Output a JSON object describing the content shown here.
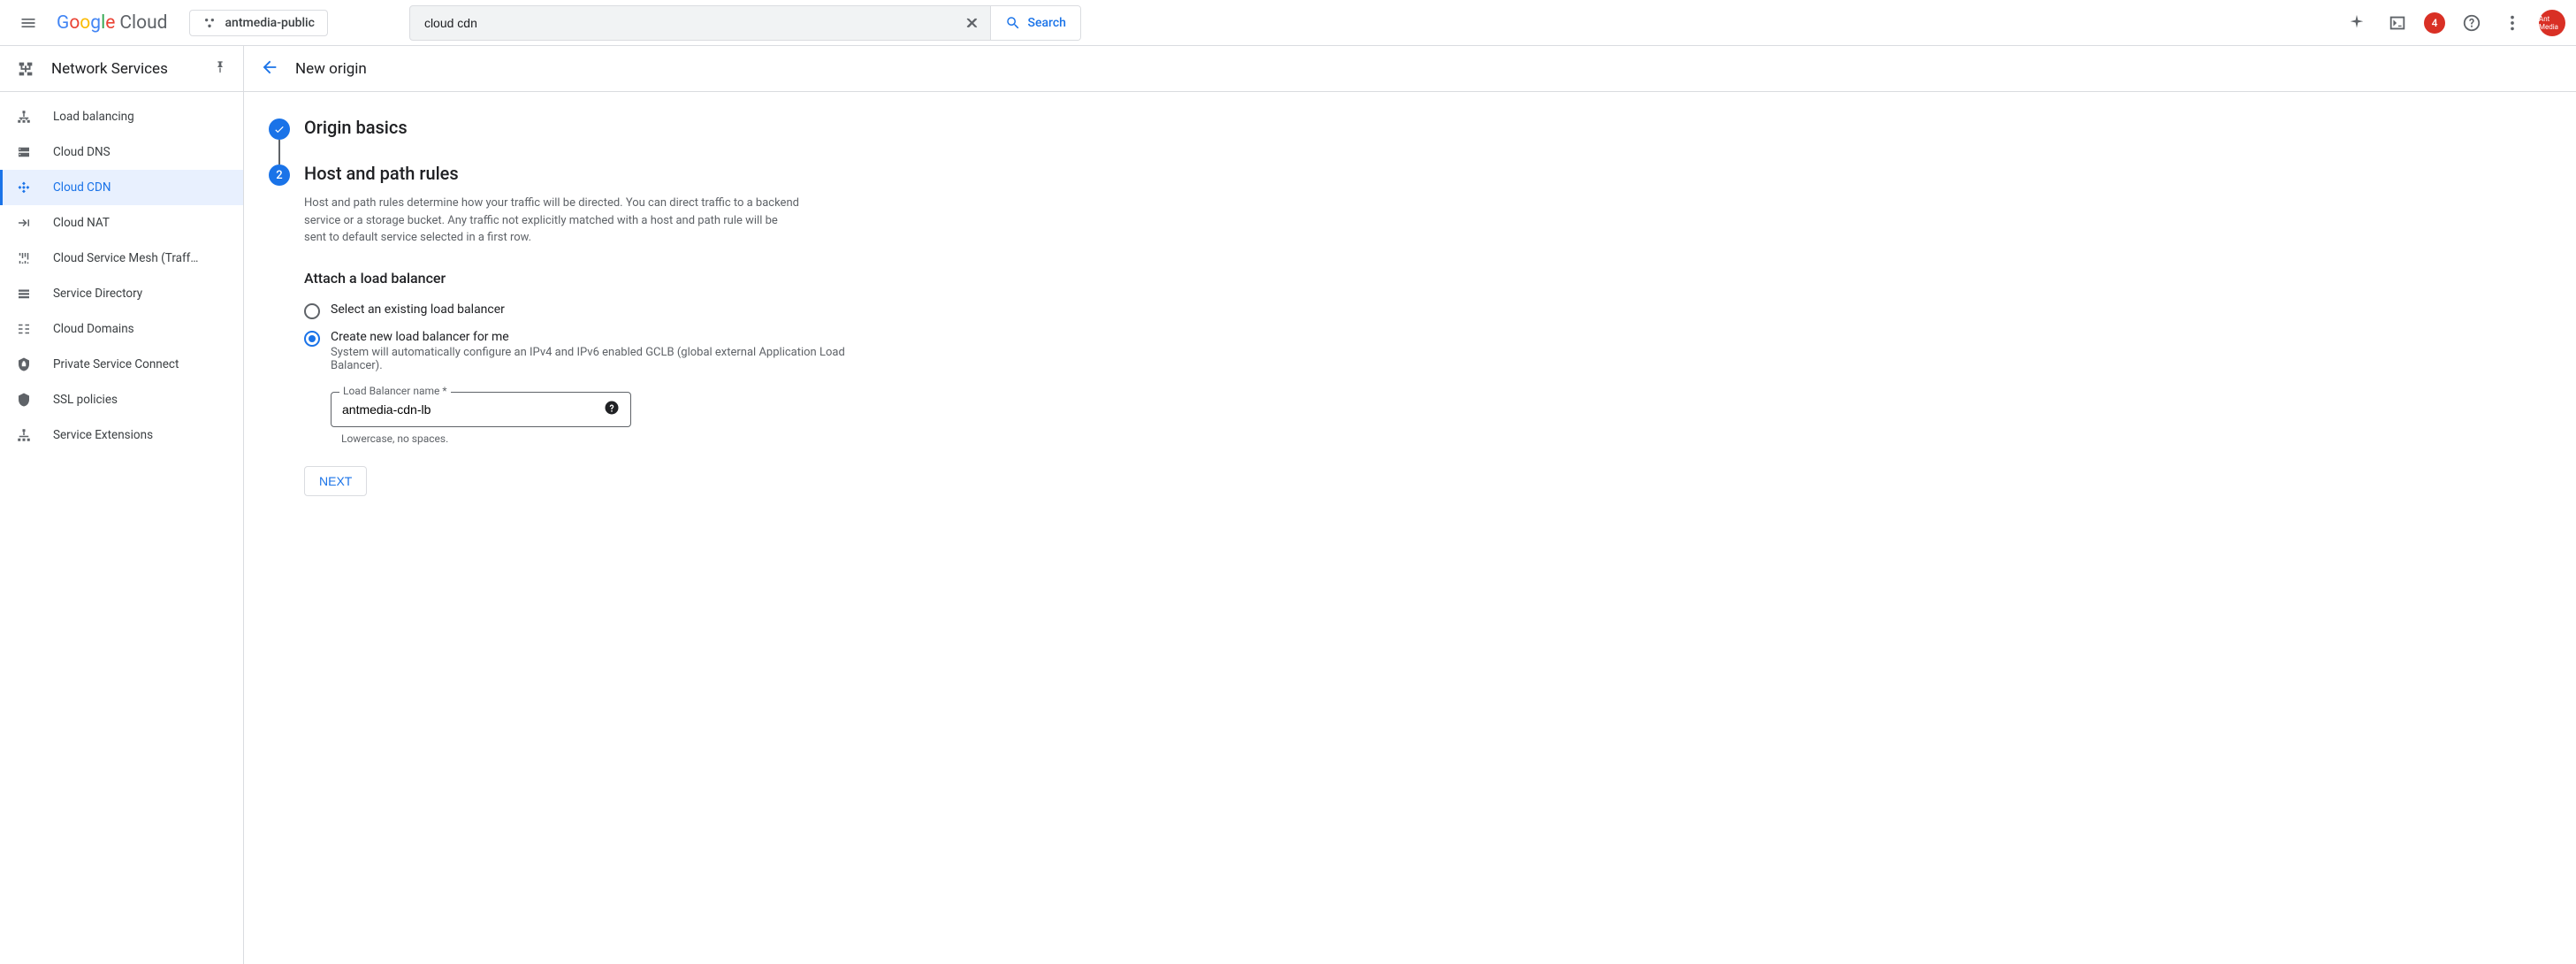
{
  "header": {
    "brand": "Google Cloud",
    "project_name": "antmedia-public",
    "search_value": "cloud cdn",
    "search_button": "Search",
    "notif_count": "4",
    "avatar_text": "Ant Media"
  },
  "sidebar": {
    "title": "Network Services",
    "items": [
      {
        "label": "Load balancing",
        "icon": "lb"
      },
      {
        "label": "Cloud DNS",
        "icon": "dns"
      },
      {
        "label": "Cloud CDN",
        "icon": "cdn",
        "active": true
      },
      {
        "label": "Cloud NAT",
        "icon": "nat"
      },
      {
        "label": "Cloud Service Mesh (Traff…",
        "icon": "mesh"
      },
      {
        "label": "Service Directory",
        "icon": "dir"
      },
      {
        "label": "Cloud Domains",
        "icon": "domains"
      },
      {
        "label": "Private Service Connect",
        "icon": "psc"
      },
      {
        "label": "SSL policies",
        "icon": "ssl"
      },
      {
        "label": "Service Extensions",
        "icon": "ext"
      }
    ]
  },
  "page": {
    "title": "New origin"
  },
  "steps": {
    "one": {
      "title": "Origin basics"
    },
    "two": {
      "number": "2",
      "title": "Host and path rules",
      "description": "Host and path rules determine how your traffic will be directed. You can direct traffic to a backend service or a storage bucket. Any traffic not explicitly matched with a host and path rule will be sent to default service selected in a first row.",
      "subsection": "Attach a load balancer",
      "radio": {
        "existing": "Select an existing load balancer",
        "create": "Create new load balancer for me",
        "create_sub": "System will automatically configure an IPv4 and IPv6 enabled GCLB (global external Application Load Balancer)."
      },
      "lb_field": {
        "label": "Load Balancer name *",
        "value": "antmedia-cdn-lb",
        "hint": "Lowercase, no spaces."
      },
      "next": "NEXT"
    }
  }
}
